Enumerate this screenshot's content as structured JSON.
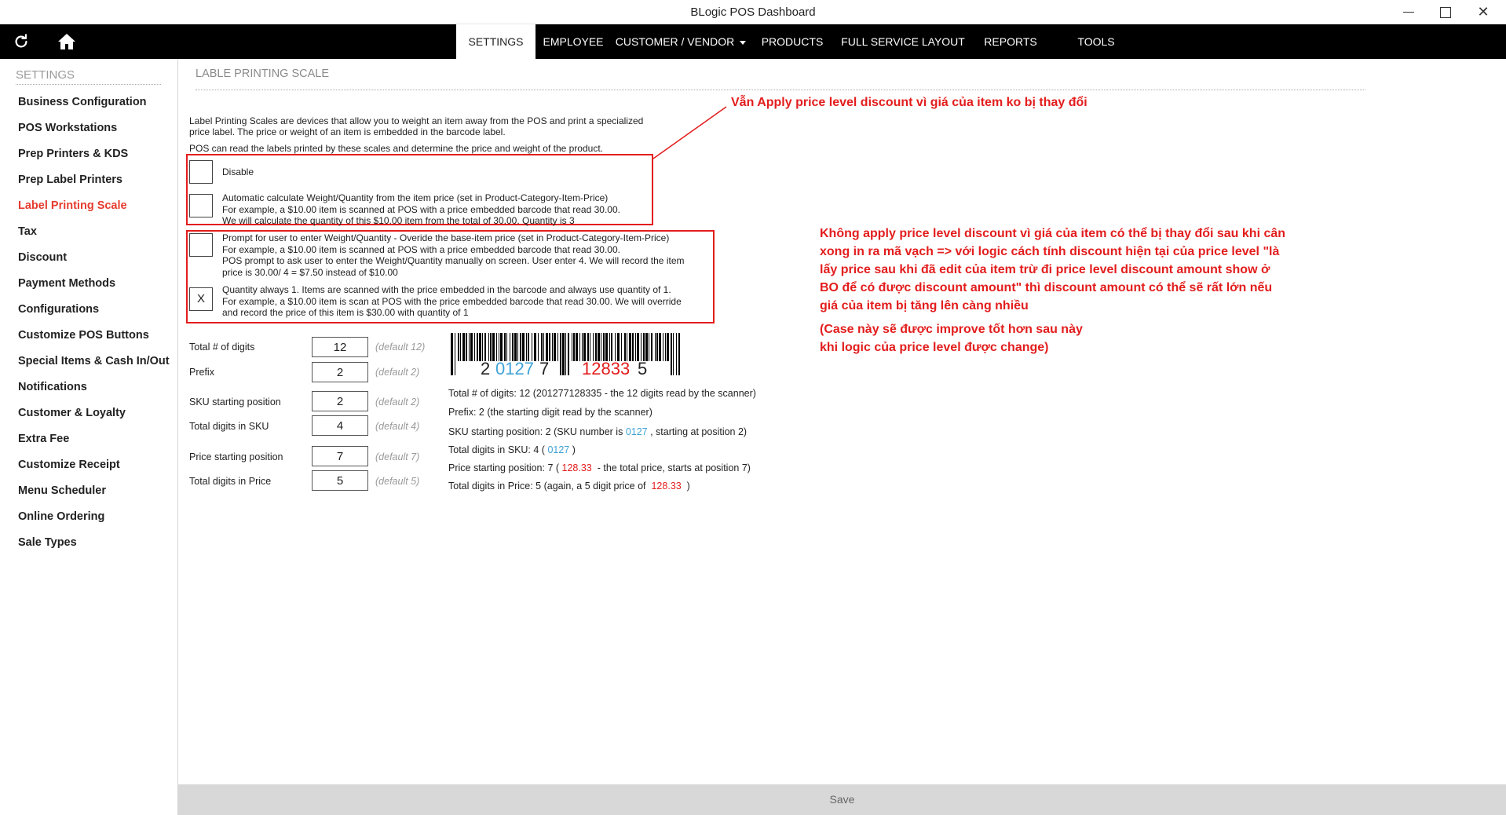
{
  "window": {
    "title": "BLogic POS Dashboard",
    "minimize_icon": "minimize-icon",
    "maximize_icon": "maximize-icon",
    "close_glyph": "✕"
  },
  "navbar": {
    "refresh_icon": "refresh-icon",
    "home_icon": "home-icon",
    "items": [
      {
        "label": "SETTINGS",
        "active": true
      },
      {
        "label": "EMPLOYEE"
      },
      {
        "label": "CUSTOMER / VENDOR",
        "dropdown": true
      },
      {
        "label": "PRODUCTS"
      },
      {
        "label": "FULL SERVICE LAYOUT"
      },
      {
        "label": "REPORTS"
      },
      {
        "label": "TOOLS"
      }
    ]
  },
  "sidebar": {
    "header": "SETTINGS",
    "items": [
      {
        "label": "Business Configuration"
      },
      {
        "label": "POS Workstations"
      },
      {
        "label": "Prep Printers & KDS"
      },
      {
        "label": "Prep Label Printers"
      },
      {
        "label": "Label Printing Scale",
        "active": true
      },
      {
        "label": "Tax"
      },
      {
        "label": "Discount"
      },
      {
        "label": "Payment Methods"
      },
      {
        "label": "Configurations"
      },
      {
        "label": "Customize POS Buttons"
      },
      {
        "label": "Special Items & Cash In/Out"
      },
      {
        "label": "Notifications"
      },
      {
        "label": "Customer & Loyalty"
      },
      {
        "label": "Extra Fee"
      },
      {
        "label": "Customize Receipt"
      },
      {
        "label": "Menu Scheduler"
      },
      {
        "label": "Online Ordering"
      },
      {
        "label": "Sale Types"
      }
    ]
  },
  "main": {
    "header": "LABLE PRINTING SCALE",
    "description": {
      "line1": "Label Printing Scales are devices that allow you to weight an item away from the POS and print a specialized",
      "line2": "price label. The price or weight of an item is embedded in the barcode label.",
      "line3": "POS can read the labels printed by these scales and determine the price and weight of the product."
    },
    "options": [
      {
        "checked": "",
        "lines": [
          "Disable"
        ]
      },
      {
        "checked": "",
        "lines": [
          "Automatic calculate Weight/Quantity from the item price (set in Product-Category-Item-Price)",
          "For example, a $10.00 item is scanned at POS with a price embedded barcode that read 30.00.",
          "We will calculate the quantity of this $10.00 item from the total of 30.00. Quantity is 3"
        ]
      },
      {
        "checked": "",
        "lines": [
          "Prompt for user to enter Weight/Quantity - Overide the base-item price (set in Product-Category-Item-Price)",
          "For example, a $10.00 item is scanned at POS with a price embedded barcode that read 30.00.",
          "POS prompt to ask user to enter the Weight/Quantity manually on screen. User enter 4. We will record the item",
          "price is 30.00/ 4 = $7.50 instead of $10.00"
        ]
      },
      {
        "checked": "X",
        "lines": [
          "Quantity always 1. Items are scanned with the price embedded in the barcode and always use quantity of 1.",
          "For example, a $10.00 item is scan at POS with the price embedded barcode that read 30.00. We will override",
          "and record the price of this item is $30.00 with quantity of 1"
        ]
      }
    ],
    "fields": [
      {
        "label": "Total # of digits",
        "value": "12",
        "default": "(default 12)"
      },
      {
        "label": "Prefix",
        "value": "2",
        "default": "(default 2)"
      },
      {
        "label": "SKU starting position",
        "value": "2",
        "default": "(default 2)"
      },
      {
        "label": "Total digits in SKU",
        "value": "4",
        "default": "(default 4)"
      },
      {
        "label": "Price starting position",
        "value": "7",
        "default": "(default 7)"
      },
      {
        "label": "Total digits in Price",
        "value": "5",
        "default": "(default 5)"
      }
    ],
    "barcode": {
      "prefix": "2",
      "sku": "0127",
      "mid": "7",
      "price": "12833",
      "check": "5",
      "colors": {
        "sku": "#3fa3d8",
        "price": "#e31d1d"
      }
    },
    "info": {
      "total_digits": "Total # of digits: 12 (201277128335 - the 12 digits read by the scanner)",
      "prefix": "Prefix: 2 (the starting digit read by the scanner)",
      "sku_pos_a": "SKU starting position: 2 (SKU number is",
      "sku_pos_b": "0127",
      "sku_pos_c": ", starting at position 2)",
      "sku_digits_a": "Total digits in SKU: 4 (",
      "sku_digits_b": "0127",
      "sku_digits_c": ")",
      "price_pos_a": "Price starting position: 7 (",
      "price_pos_b": "128.33",
      "price_pos_c": "- the total price, starts at position 7)",
      "price_digits_a": "Total digits in Price: 5 (again, a 5 digit price of",
      "price_digits_b": "128.33",
      "price_digits_c": ")"
    }
  },
  "annotations": {
    "top": "Vẫn Apply price level discount vì giá của item ko bị thay đổi",
    "right_lines": [
      "Không apply price level discount vì giá của item có thể bị thay đổi sau khi cân",
      "xong in ra mã vạch => với logic cách tính discount hiện tại của price level \"là",
      "lấy price sau khi đã edit của item trừ đi price level discount amount show ở",
      "BO để có được discount amount\" thì discount amount có thể sẽ rất lớn nếu",
      "giá của item bị tăng lên càng nhiều"
    ],
    "note_lines": [
      "(Case này sẽ được improve tốt hơn sau này",
      "khi logic của price level được change)"
    ],
    "color": "#e31d1d"
  },
  "footer": {
    "save_label": "Save"
  }
}
